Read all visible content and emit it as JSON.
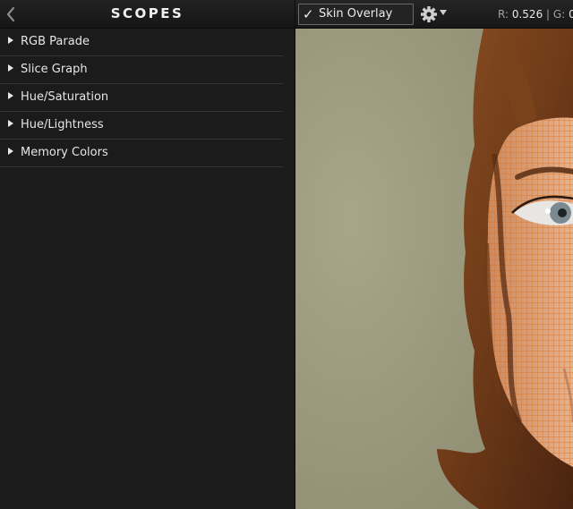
{
  "panel": {
    "title": "SCOPES",
    "back_icon": "chevron-left-icon",
    "items": [
      {
        "label": "RGB Parade"
      },
      {
        "label": "Slice Graph"
      },
      {
        "label": "Hue/Saturation"
      },
      {
        "label": "Hue/Lightness"
      },
      {
        "label": "Memory Colors"
      }
    ]
  },
  "toolbar": {
    "overlay_label": "Skin Overlay",
    "overlay_checked": true,
    "check_glyph": "✓",
    "settings_icon": "gear-icon",
    "readout": {
      "r_label": "R:",
      "r_value": "0.526",
      "separator": "|",
      "g_label": "G:",
      "g_value": "0"
    }
  },
  "viewer": {
    "image": "portrait with skin overlay grid",
    "overlay_color": "#e0701e",
    "backdrop_color": "#9e9c80",
    "hair_color": "#6e3a18"
  }
}
